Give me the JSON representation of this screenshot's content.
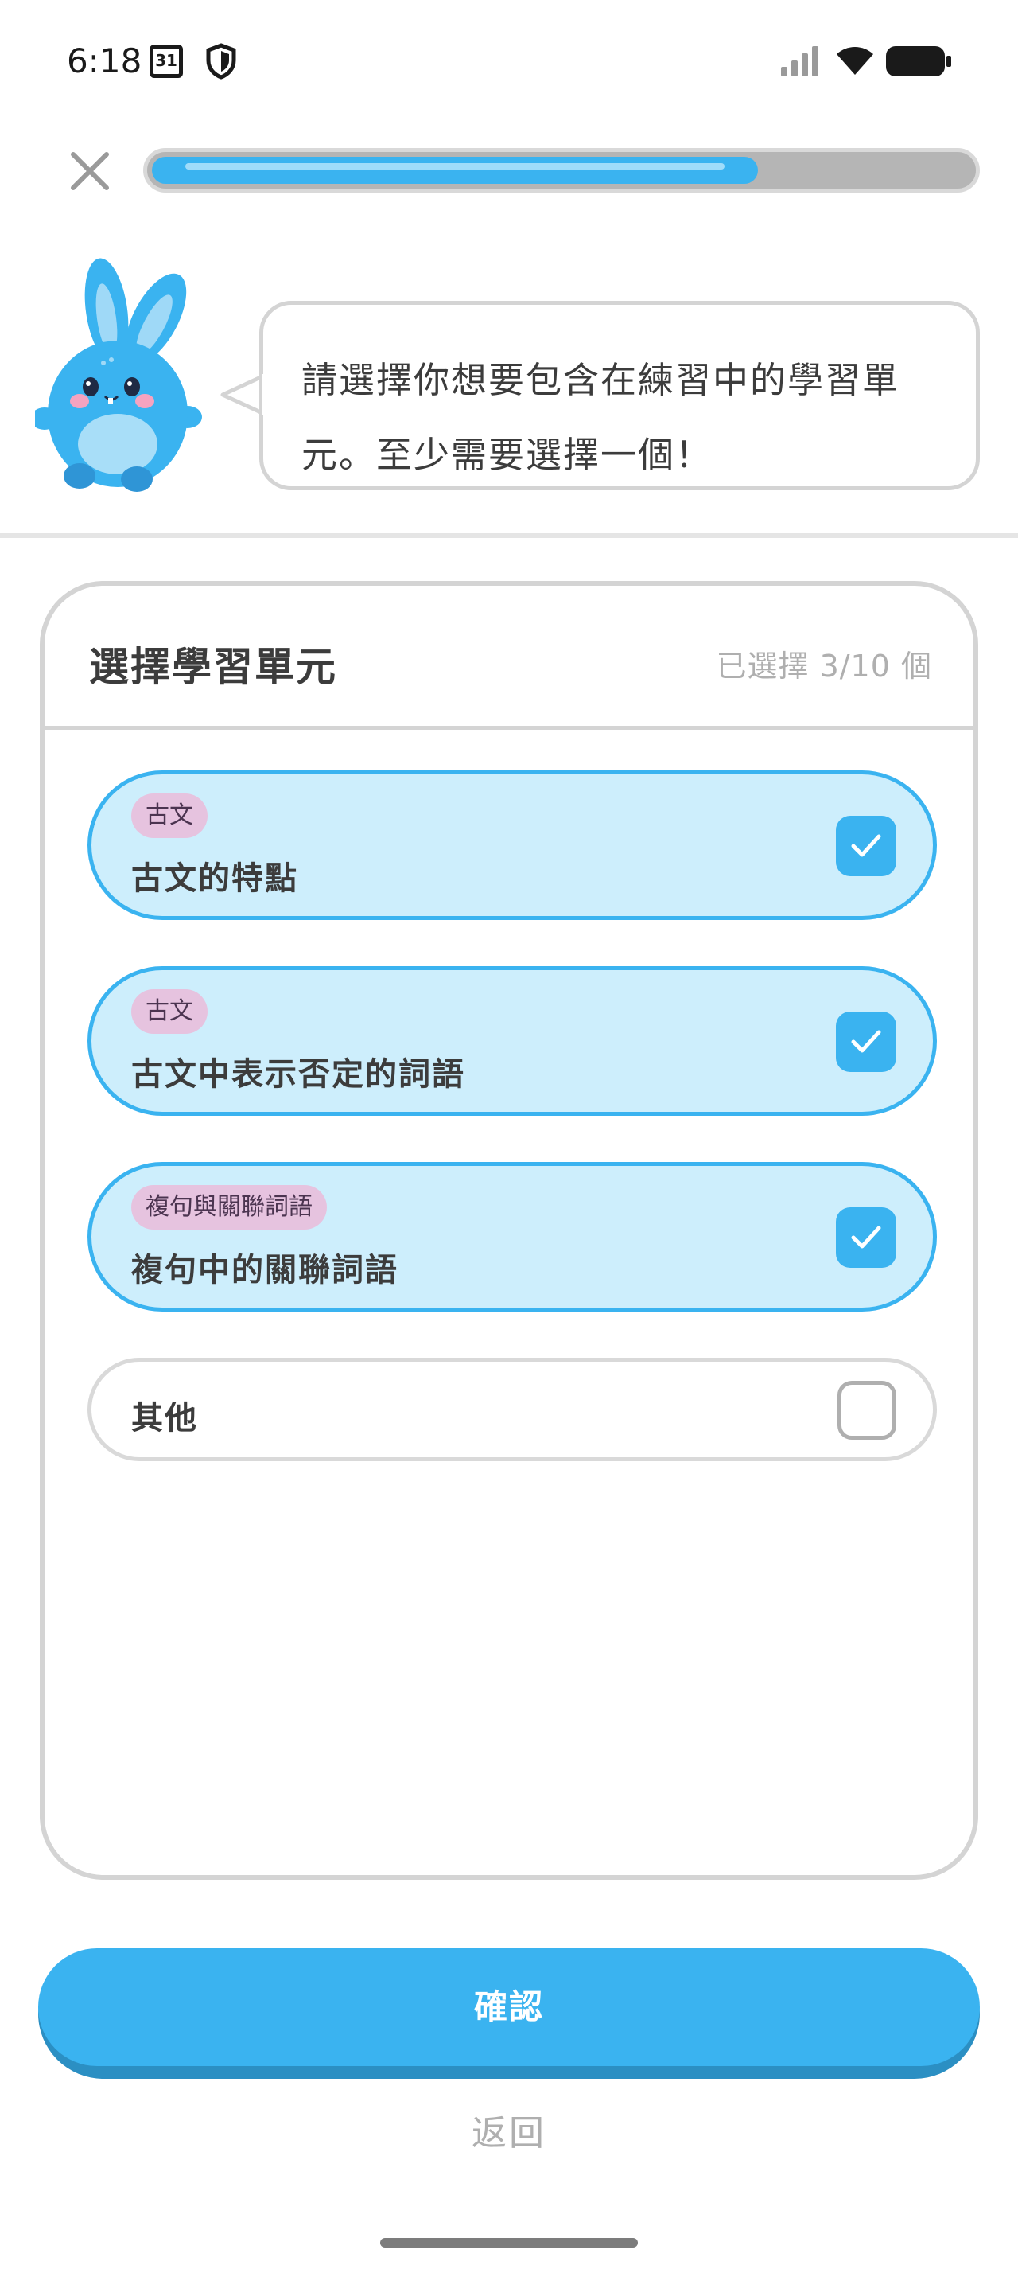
{
  "status_bar": {
    "time": "6:18",
    "calendar_day": "31"
  },
  "progress": {
    "fraction": 0.74
  },
  "speech": {
    "line1": "請選擇你想要包含在練習中的學習單",
    "line2": "元。至少需要選擇一個！"
  },
  "card": {
    "title": "選擇學習單元",
    "count_text": "已選擇 3/10 個",
    "options": [
      {
        "tag": "古文",
        "label": "古文的特點",
        "selected": true
      },
      {
        "tag": "古文",
        "label": "古文中表示否定的詞語",
        "selected": true
      },
      {
        "tag": "複句與關聯詞語",
        "label": "複句中的關聯詞語",
        "selected": true
      },
      {
        "tag": "",
        "label": "其他",
        "selected": false
      }
    ]
  },
  "buttons": {
    "confirm_label": "確認",
    "back_label": "返回"
  },
  "colors": {
    "accent": "#3ab3f0",
    "accent_dark": "#2b8fc3",
    "selected_bg": "#cdeefc",
    "tag_bg": "#e6c3df",
    "border_gray": "#d4d4d4"
  },
  "icons": {
    "close": "close-icon",
    "check": "checkmark-icon",
    "mascot": "bunny-mascot"
  }
}
